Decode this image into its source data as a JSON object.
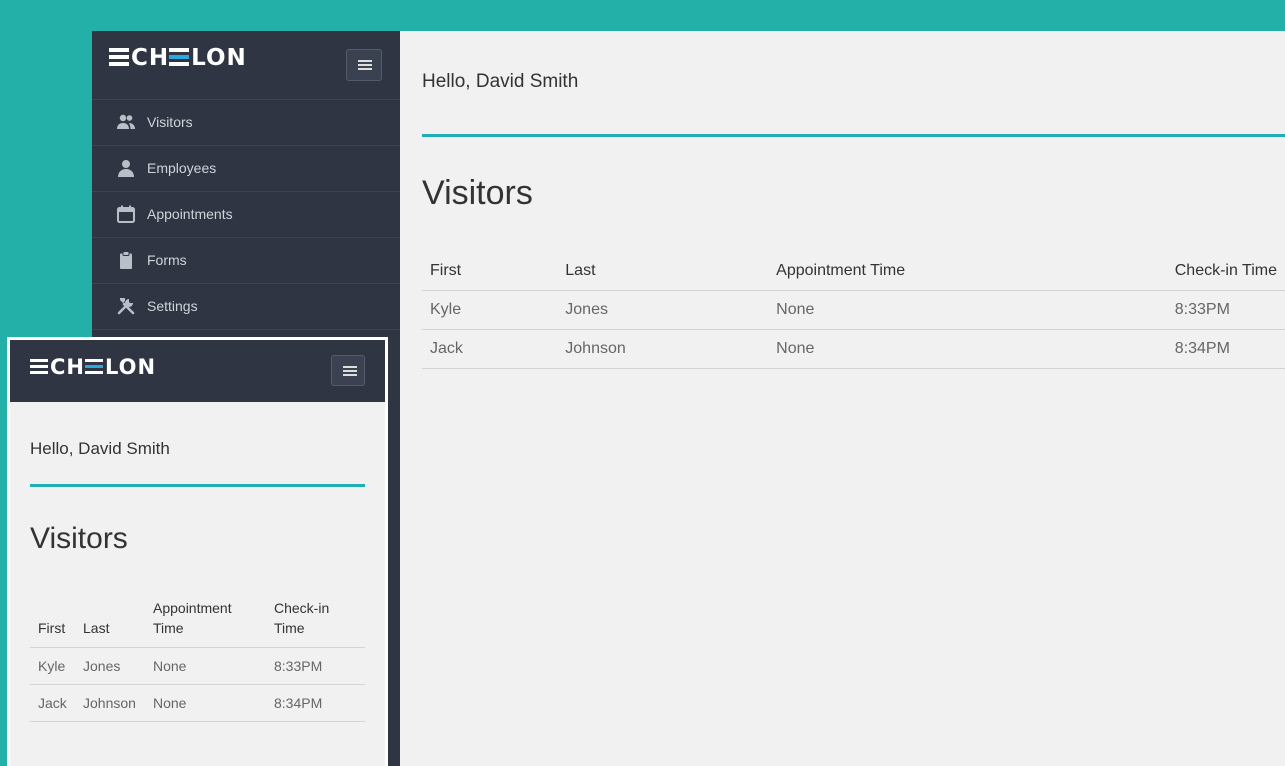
{
  "brand": {
    "logo_text": "ECHELON"
  },
  "sidebar": {
    "items": [
      {
        "label": "Visitors",
        "icon": "users-icon"
      },
      {
        "label": "Employees",
        "icon": "user-icon"
      },
      {
        "label": "Appointments",
        "icon": "calendar-icon"
      },
      {
        "label": "Forms",
        "icon": "clipboard-icon"
      },
      {
        "label": "Settings",
        "icon": "tools-icon"
      }
    ]
  },
  "main": {
    "greeting": "Hello, David Smith",
    "title": "Visitors",
    "table": {
      "headers": [
        "First",
        "Last",
        "Appointment Time",
        "Check-in Time"
      ],
      "rows": [
        [
          "Kyle",
          "Jones",
          "None",
          "8:33PM"
        ],
        [
          "Jack",
          "Johnson",
          "None",
          "8:34PM"
        ]
      ]
    }
  },
  "mobile": {
    "greeting": "Hello, David Smith",
    "title": "Visitors",
    "table": {
      "headers": [
        "First",
        "Last",
        "Appointment Time",
        "Check-in Time"
      ],
      "rows": [
        [
          "Kyle",
          "Jones",
          "None",
          "8:33PM"
        ],
        [
          "Jack",
          "Johnson",
          "None",
          "8:34PM"
        ]
      ]
    }
  },
  "colors": {
    "background": "#22b0a8",
    "sidebar": "#2f3542",
    "accent": "#1fafb8",
    "content": "#f1f1f1"
  }
}
